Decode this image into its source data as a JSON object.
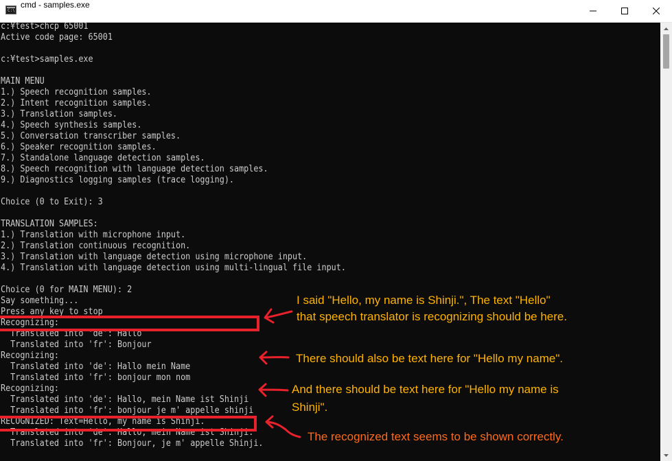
{
  "window": {
    "title": "cmd - samples.exe",
    "icon": "cmd-icon",
    "icon_text": "C:\\"
  },
  "terminal": {
    "lines": [
      "c:¥test>chcp 65001",
      "Active code page: 65001",
      "",
      "c:¥test>samples.exe",
      "",
      "MAIN MENU",
      "1.) Speech recognition samples.",
      "2.) Intent recognition samples.",
      "3.) Translation samples.",
      "4.) Speech synthesis samples.",
      "5.) Conversation transcriber samples.",
      "6.) Speaker recognition samples.",
      "7.) Standalone language detection samples.",
      "8.) Speech recognition with language detection samples.",
      "9.) Diagnostics logging samples (trace logging).",
      "",
      "Choice (0 to Exit): 3",
      "",
      "TRANSLATION SAMPLES:",
      "1.) Translation with microphone input.",
      "2.) Translation continuous recognition.",
      "3.) Translation with language detection using microphone input.",
      "4.) Translation with language detection using multi-lingual file input.",
      "",
      "Choice (0 for MAIN MENU): 2",
      "Say something...",
      "Press any key to stop",
      "Recognizing:",
      "  Translated into 'de': Hallo",
      "  Translated into 'fr': Bonjour",
      "Recognizing:",
      "  Translated into 'de': Hallo mein Name",
      "  Translated into 'fr': bonjour mon nom",
      "Recognizing:",
      "  Translated into 'de': Hallo, mein Name ist Shinji",
      "  Translated into 'fr': bonjour je m' appelle shinji",
      "RECOGNIZED: Text=Hello, my name is Shinji.",
      "  Translated into 'de': Hallo, mein Name ist Shinji.",
      "  Translated into 'fr': Bonjour, je m' appelle Shinji."
    ]
  },
  "annotations": {
    "note1_line1": "I said \"Hello, my name is Shinji.\", The text \"Hello\"",
    "note1_line2": "that speech translator is recognizing should be here.",
    "note2": "There should also be text here for \"Hello my name\".",
    "note3_line1": "And there should be text here for \"Hello my name is",
    "note3_line2": "Shinji\".",
    "note4": "The recognized text seems to be shown correctly.",
    "colors": {
      "note": "#ffb300",
      "note_red": "#ff6a1a",
      "highlight": "#e8212b"
    }
  }
}
